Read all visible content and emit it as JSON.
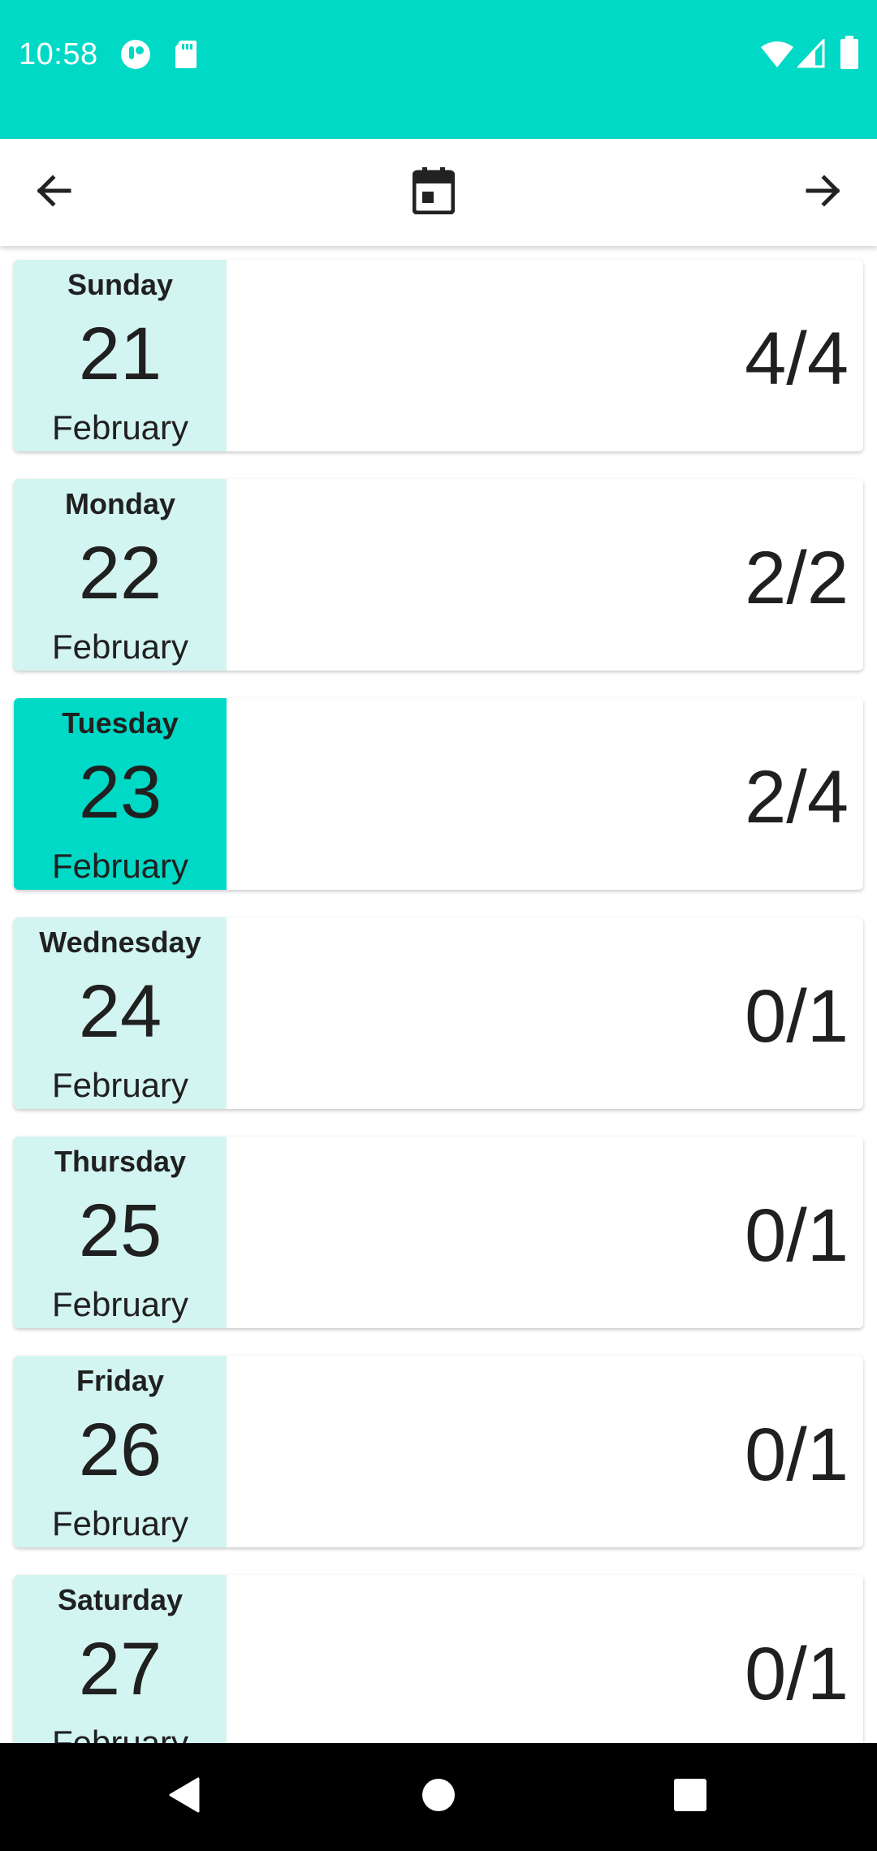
{
  "status_bar": {
    "time": "10:58",
    "icons": [
      "notification-app-icon",
      "sd-card-icon",
      "wifi-icon",
      "cellular-signal-icon",
      "battery-icon"
    ],
    "background": "#00d9c6"
  },
  "toolbar": {
    "back_icon": "arrow-left-icon",
    "calendar_icon": "calendar-icon",
    "forward_icon": "arrow-right-icon"
  },
  "days": [
    {
      "weekday": "Sunday",
      "day": "21",
      "month": "February",
      "count": "4/4",
      "selected": false
    },
    {
      "weekday": "Monday",
      "day": "22",
      "month": "February",
      "count": "2/2",
      "selected": false
    },
    {
      "weekday": "Tuesday",
      "day": "23",
      "month": "February",
      "count": "2/4",
      "selected": true
    },
    {
      "weekday": "Wednesday",
      "day": "24",
      "month": "February",
      "count": "0/1",
      "selected": false
    },
    {
      "weekday": "Thursday",
      "day": "25",
      "month": "February",
      "count": "0/1",
      "selected": false
    },
    {
      "weekday": "Friday",
      "day": "26",
      "month": "February",
      "count": "0/1",
      "selected": false
    },
    {
      "weekday": "Saturday",
      "day": "27",
      "month": "February",
      "count": "0/1",
      "selected": false
    }
  ],
  "colors": {
    "accent": "#00d9c6",
    "date_panel": "#d3f5f1"
  },
  "nav_bar": {
    "icons": [
      "nav-back-icon",
      "nav-home-icon",
      "nav-recents-icon"
    ]
  }
}
